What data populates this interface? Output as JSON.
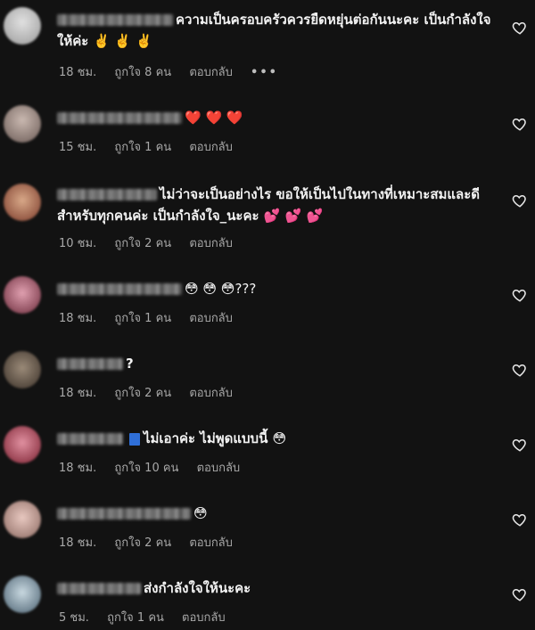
{
  "comments": [
    {
      "avatar_color": "#cfcfcf",
      "uname_w": 130,
      "text": "ความเป็นครอบครัวควรยืดหยุ่นต่อกันนะคะ เป็นกำลังใจให้ค่ะ ✌️ ✌️ ✌️",
      "time": "18 ชม.",
      "likes": "ถูกใจ 8 คน",
      "reply": "ตอบกลับ",
      "more": "•••"
    },
    {
      "avatar_color": "#9c8f8a",
      "uname_w": 140,
      "text": "❤️ ❤️ ❤️",
      "time": "15 ชม.",
      "likes": "ถูกใจ 1 คน",
      "reply": "ตอบกลับ"
    },
    {
      "avatar_color": "#a0664a",
      "uname_w": 112,
      "text": "ไม่ว่าจะเป็นอย่างไร ขอให้เป็นไปในทางที่เหมาะสมและดีสำหรับทุกคนค่ะ เป็นกำลังใจ_นะคะ 💕 💕 💕",
      "time": "10 ชม.",
      "likes": "ถูกใจ 2 คน",
      "reply": "ตอบกลับ"
    },
    {
      "avatar_color": "#b06a7a",
      "uname_w": 140,
      "text": "😳 😳 😳???",
      "time": "18 ชม.",
      "likes": "ถูกใจ 1 คน",
      "reply": "ตอบกลับ"
    },
    {
      "avatar_color": "#6e5e4e",
      "uname_w": 74,
      "text": "?",
      "time": "18 ชม.",
      "likes": "ถูกใจ 2 คน",
      "reply": "ตอบกลับ"
    },
    {
      "avatar_color": "#b0485a",
      "uname_w": 74,
      "badge": true,
      "text": "ไม่เอาค่ะ ไม่พูดแบบนี้ 😳",
      "time": "18 ชม.",
      "likes": "ถูกใจ 10 คน",
      "reply": "ตอบกลับ"
    },
    {
      "avatar_color": "#c9a7a0",
      "uname_w": 150,
      "text": "😳",
      "time": "18 ชม.",
      "likes": "ถูกใจ 2 คน",
      "reply": "ตอบกลับ"
    },
    {
      "avatar_color": "#8aa0b0",
      "uname_w": 94,
      "text": "ส่งกำลังใจให้นะคะ",
      "time": "5 ชม.",
      "likes": "ถูกใจ 1 คน",
      "reply": "ตอบกลับ"
    }
  ]
}
